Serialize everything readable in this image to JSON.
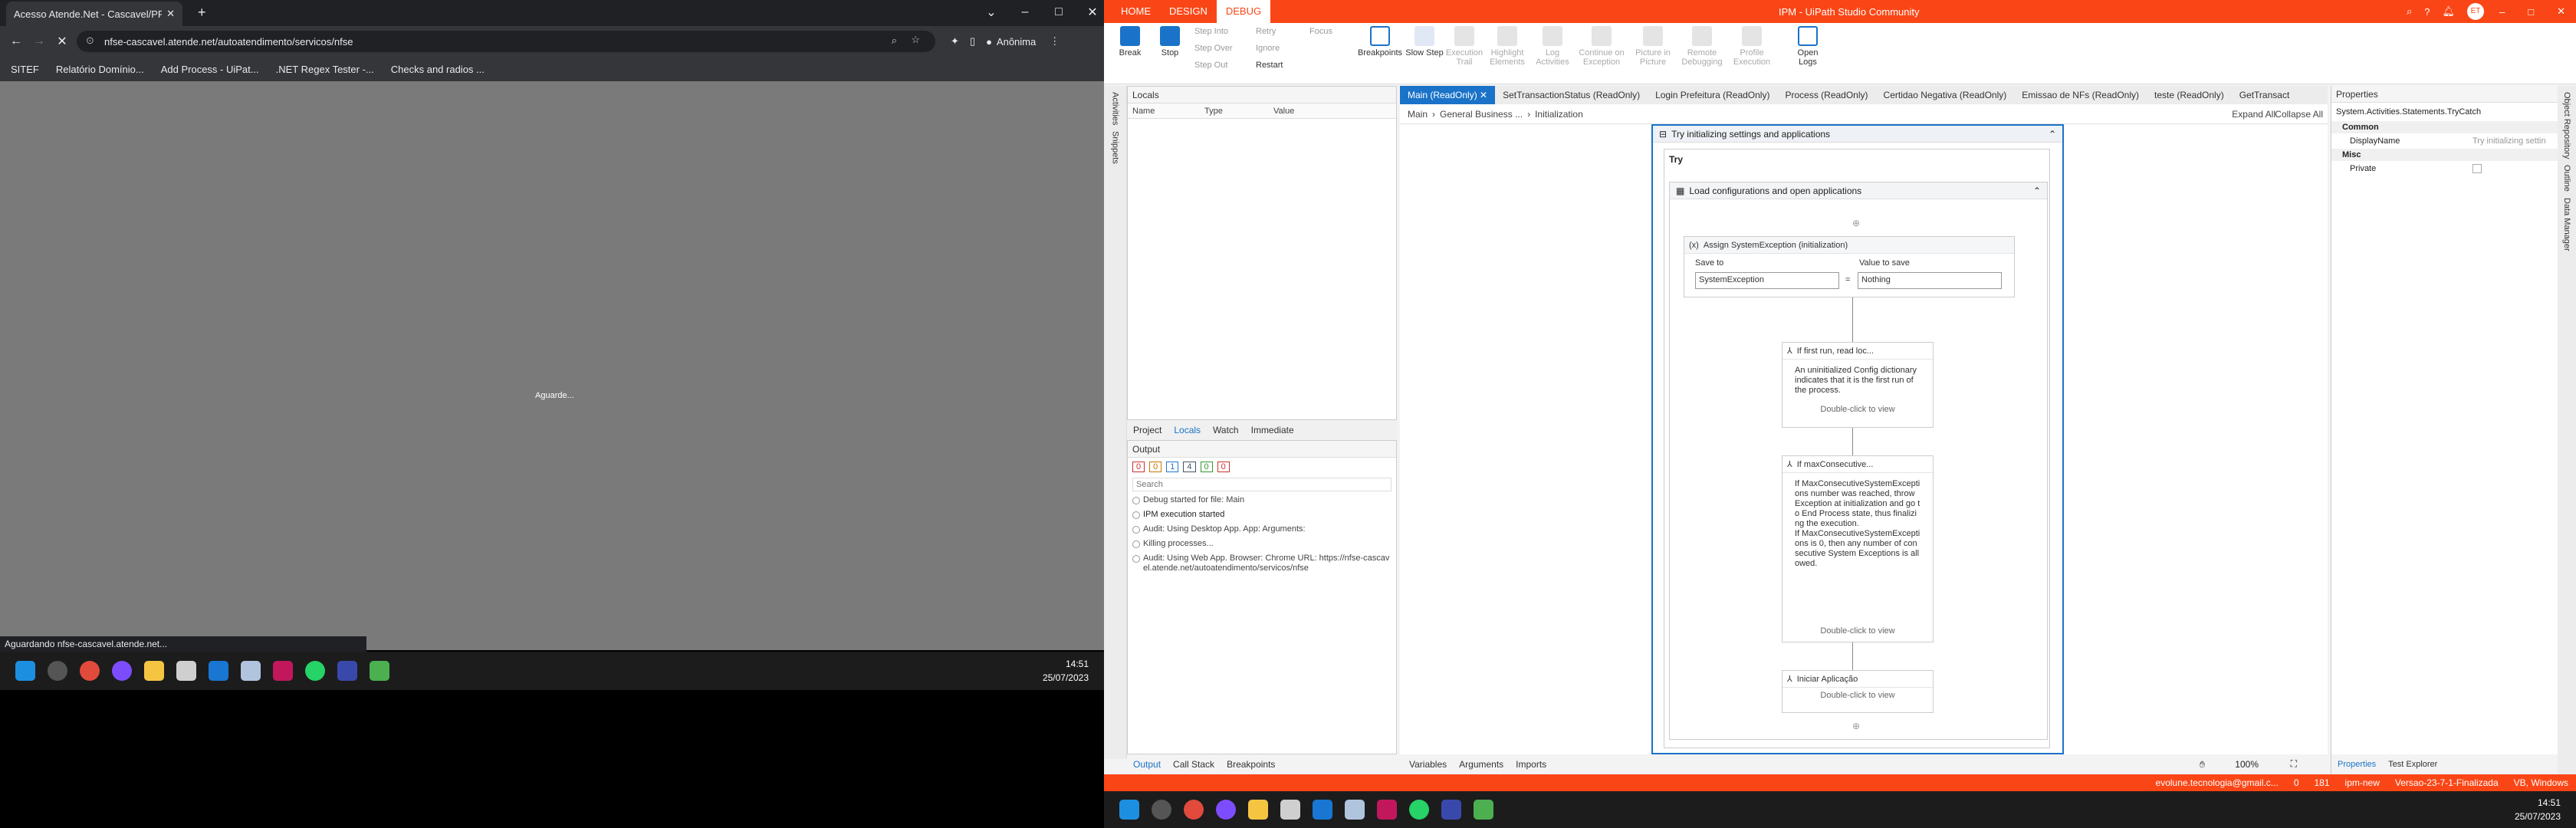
{
  "browser": {
    "tab_title": "Acesso Atende.Net - Cascavel/PR",
    "url": "nfse-cascavel.atende.net/autoatendimento/servicos/nfse",
    "profile": "Anônima",
    "bookmarks": [
      "SITEF",
      "Relatório Domínio...",
      "Add Process - UiPat...",
      ".NET Regex Tester -...",
      "Checks and radios ..."
    ],
    "loading_text": "Aguarde...",
    "status_bubble": "Aguardando nfse-cascavel.atende.net..."
  },
  "taskbar_left": {
    "time": "14:51",
    "date": "25/07/2023"
  },
  "studio": {
    "window_title": "IPM - UiPath Studio Community",
    "menu": [
      "HOME",
      "DESIGN",
      "DEBUG"
    ],
    "user_initials": "ET",
    "ribbon": {
      "break": "Break",
      "stop": "Stop",
      "step_into": "Step Into",
      "step_over": "Step Over",
      "step_out": "Step Out",
      "retry": "Retry",
      "ignore": "Ignore",
      "restart": "Restart",
      "focus": "Focus",
      "breakpoints": "Breakpoints",
      "slow_step": "Slow Step",
      "execution_trail": "Execution Trail",
      "highlight_elements": "Highlight Elements",
      "log_activities": "Log Activities",
      "continue_on_exception": "Continue on Exception",
      "picture_in_picture": "Picture in Picture",
      "remote_debugging": "Remote Debugging",
      "profile_execution": "Profile Execution",
      "open_logs": "Open Logs"
    },
    "left_strip": [
      "Activities",
      "Snippets"
    ],
    "locals": {
      "title": "Locals",
      "cols": [
        "Name",
        "Type",
        "Value"
      ]
    },
    "panel_tabs": [
      "Project",
      "Locals",
      "Watch",
      "Immediate"
    ],
    "output": {
      "title": "Output",
      "counts": [
        "0",
        "0",
        "1",
        "4",
        "0",
        "0"
      ],
      "search_placeholder": "Search",
      "lines": [
        "Debug started for file: Main",
        "IPM execution started",
        "Audit: Using Desktop App. App:  Arguments:",
        "Killing processes...",
        "Audit: Using Web App. Browser: Chrome URL: https://nfse-cascavel.atende.net/autoatendimento/servicos/nfse"
      ]
    },
    "output_tabs": [
      "Output",
      "Call Stack",
      "Breakpoints"
    ],
    "doc_tabs": [
      "Main (ReadOnly)",
      "SetTransactionStatus (ReadOnly)",
      "Login Prefeitura (ReadOnly)",
      "Process (ReadOnly)",
      "Certidao Negativa (ReadOnly)",
      "Emissao de NFs (ReadOnly)",
      "teste (ReadOnly)",
      "GetTransact"
    ],
    "breadcrumb": [
      "Main",
      "General Business ...",
      "Initialization"
    ],
    "expand_all": "Expand All",
    "collapse_all": "Collapse All",
    "workflow": {
      "try_catch_title": "Try initializing settings and applications",
      "try_label": "Try",
      "sequence_title": "Load configurations and open applications",
      "assign_title": "Assign SystemException (initialization)",
      "save_to_label": "Save to",
      "value_label": "Value to save",
      "save_to_value": "SystemException",
      "value_value": "Nothing",
      "if1_title": "If first run, read loc...",
      "if1_text": "An uninitialized Config dictionary indicates that it is the first run of the process.",
      "if2_title": "If maxConsecutive...",
      "if2_text": "If MaxConsecutiveSystemExceptions number was reached, throw Exception at initialization and go to End Process state, thus finalizing the execution.\nIf MaxConsecutiveSystemExceptions is 0, then any number of consecutive System Exceptions is allowed.",
      "invoke_title": "Iniciar Aplicação",
      "double_click": "Double-click to view"
    },
    "designer_tabs": [
      "Variables",
      "Arguments",
      "Imports"
    ],
    "zoom": "100%",
    "properties": {
      "title": "Properties",
      "type": "System.Activities.Statements.TryCatch",
      "common": "Common",
      "display_name_label": "DisplayName",
      "display_name_value": "Try initializing settin",
      "misc": "Misc",
      "private_label": "Private"
    },
    "right_strip": [
      "Object Repository",
      "Outline",
      "Data Manager"
    ],
    "props_tabs": [
      "Properties",
      "Test Explorer"
    ],
    "statusbar": {
      "account": "evolune.tecnologia@gmail.c...",
      "errors": "0",
      "count": "181",
      "branch": "ipm-new",
      "version": "Versao-23-7-1-Finalizada",
      "platform": "VB, Windows"
    },
    "taskbar": {
      "time": "14:51",
      "date": "25/07/2023"
    }
  }
}
